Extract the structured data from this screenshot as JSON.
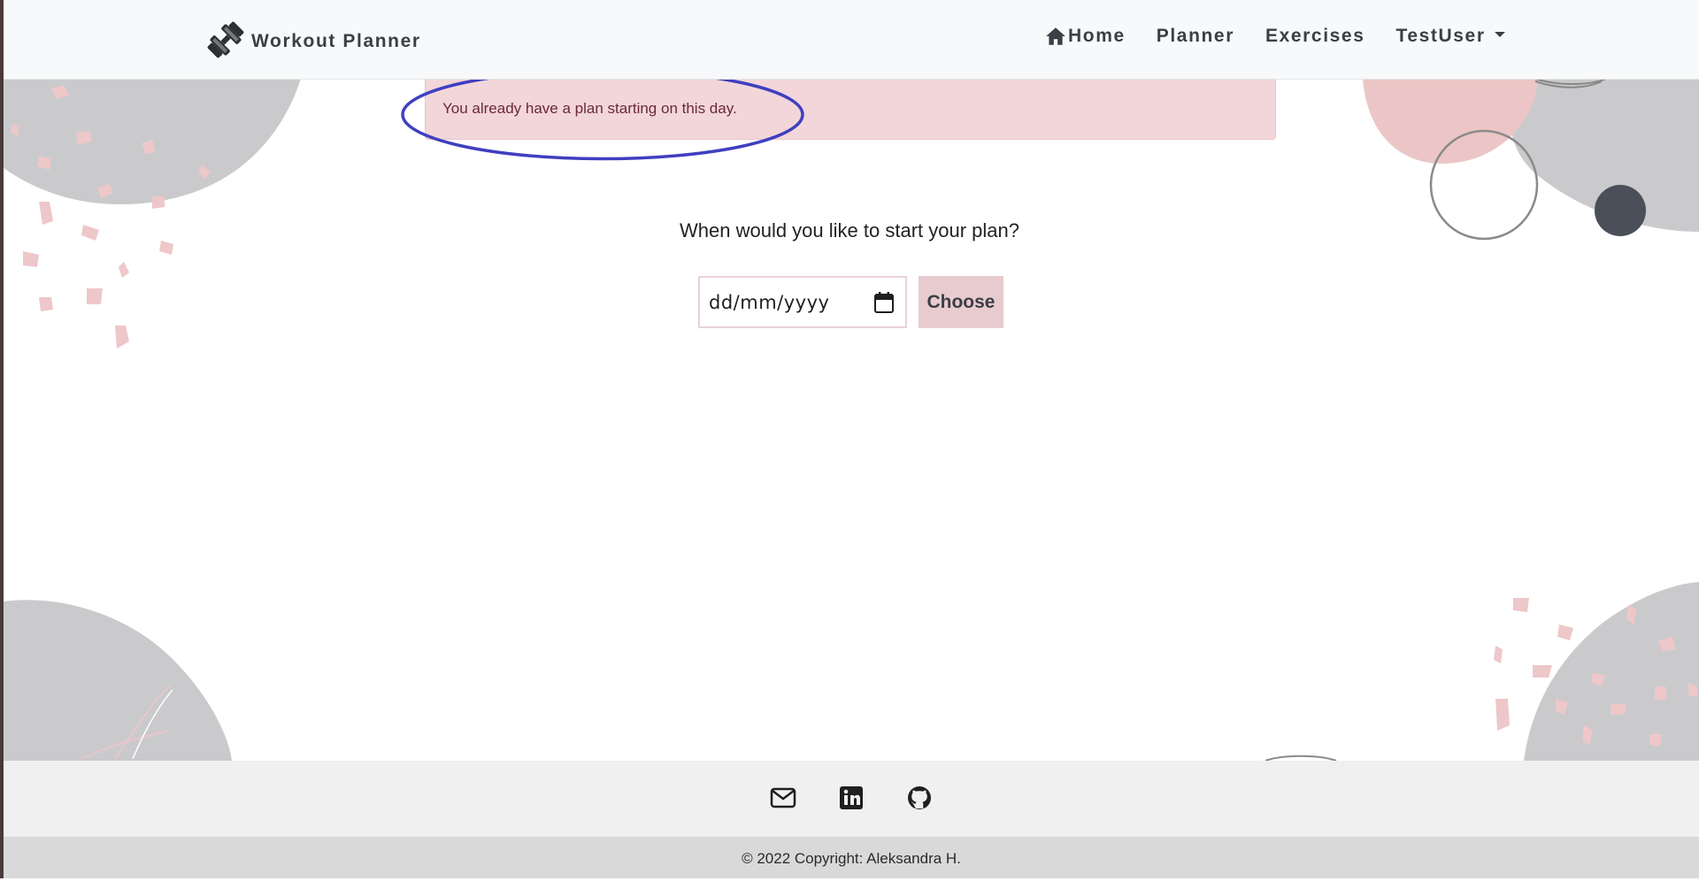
{
  "brand": {
    "name": "Workout Planner",
    "icon": "dumbbell-icon"
  },
  "nav": {
    "home_label": "Home",
    "home_icon": "home-icon",
    "planner_label": "Planner",
    "exercises_label": "Exercises",
    "user_label": "TestUser"
  },
  "alert": {
    "message": "You already have a plan starting on this day."
  },
  "form": {
    "question": "When would you like to start your plan?",
    "date_placeholder": "dd/mm/yyyy",
    "choose_label": "Choose"
  },
  "footer": {
    "social_icons": [
      "mail-icon",
      "linkedin-icon",
      "github-icon"
    ],
    "copyright": "© 2022 Copyright: Aleksandra H."
  },
  "colors": {
    "navbar_bg": "#f8f9fa",
    "alert_bg": "#f2d6d9",
    "alert_text": "#6b2a33",
    "button_bg": "#e8cbce",
    "annotation": "#3f3fc0",
    "footer_bg": "#f0f0f0",
    "copyright_bg": "#d9d9d9"
  }
}
